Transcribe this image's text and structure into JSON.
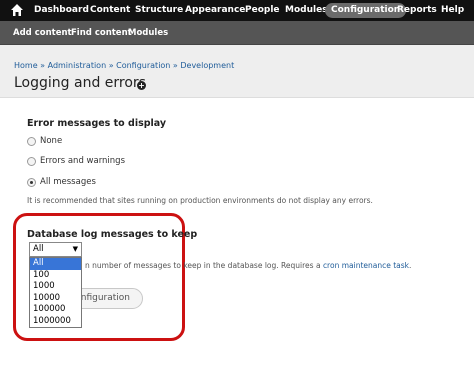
{
  "toolbar": {
    "home_icon": "home-icon",
    "items": [
      "Dashboard",
      "Content",
      "Structure",
      "Appearance",
      "People",
      "Modules",
      "Configuration",
      "Reports",
      "Help"
    ],
    "active": "Configuration"
  },
  "shortcuts": {
    "items": [
      "Add content",
      "Find content",
      "Modules"
    ]
  },
  "header": {
    "breadcrumb": "Home » Administration » Configuration » Development",
    "title": "Logging and errors",
    "title_icon": "plus-icon"
  },
  "error_display": {
    "label": "Error messages to display",
    "options": [
      "None",
      "Errors and warnings",
      "All messages"
    ],
    "selected": "All messages",
    "description": "It is recommended that sites running on production environments do not display any errors."
  },
  "db_log": {
    "label": "Database log messages to keep",
    "selected": "All",
    "options": [
      "All",
      "100",
      "1000",
      "10000",
      "100000",
      "1000000"
    ],
    "description_prefix": "n number of messages to keep in the database log. Requires a ",
    "description_link": "cron maintenance task",
    "description_suffix": "."
  },
  "save_button": {
    "label": "nfiguration"
  },
  "colors": {
    "toolbar_bg": "#111111",
    "shortcut_bg": "#555555",
    "link": "#1f5c99",
    "highlight": "#cc1111",
    "selected_option": "#3875d7"
  }
}
